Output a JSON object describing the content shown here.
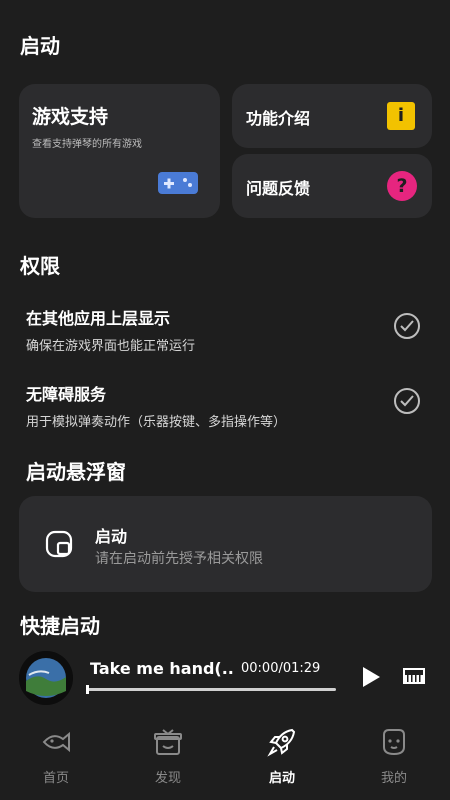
{
  "sections": {
    "launch_title": "启动",
    "permissions_title": "权限",
    "floating_title": "启动悬浮窗",
    "quick_title": "快捷启动"
  },
  "cards": {
    "game_support": {
      "title": "游戏支持",
      "subtitle": "查看支持弹琴的所有游戏"
    },
    "features": {
      "title": "功能介绍",
      "icon_glyph": "i"
    },
    "faq": {
      "title": "问题反馈",
      "icon_glyph": "?"
    }
  },
  "permissions": [
    {
      "title": "在其他应用上层显示",
      "subtitle": "确保在游戏界面也能正常运行",
      "granted": true
    },
    {
      "title": "无障碍服务",
      "subtitle": "用于模拟弹奏动作（乐器按键、多指操作等）",
      "granted": true
    }
  ],
  "floating": {
    "title": "启动",
    "subtitle": "请在启动前先授予相关权限"
  },
  "player": {
    "track_title": "Take me hand(..",
    "time": "00:00/01:29",
    "progress": 0.0
  },
  "nav": [
    {
      "label": "首页",
      "icon": "fish-icon",
      "active": false
    },
    {
      "label": "发现",
      "icon": "gift-icon",
      "active": false
    },
    {
      "label": "启动",
      "icon": "rocket-icon",
      "active": true
    },
    {
      "label": "我的",
      "icon": "face-icon",
      "active": false
    }
  ],
  "colors": {
    "background": "#1e1e1e",
    "card": "#2c2c2e",
    "info_icon": "#f2c200",
    "help_icon": "#e6257f",
    "gamepad_icon": "#4a7bd6"
  }
}
